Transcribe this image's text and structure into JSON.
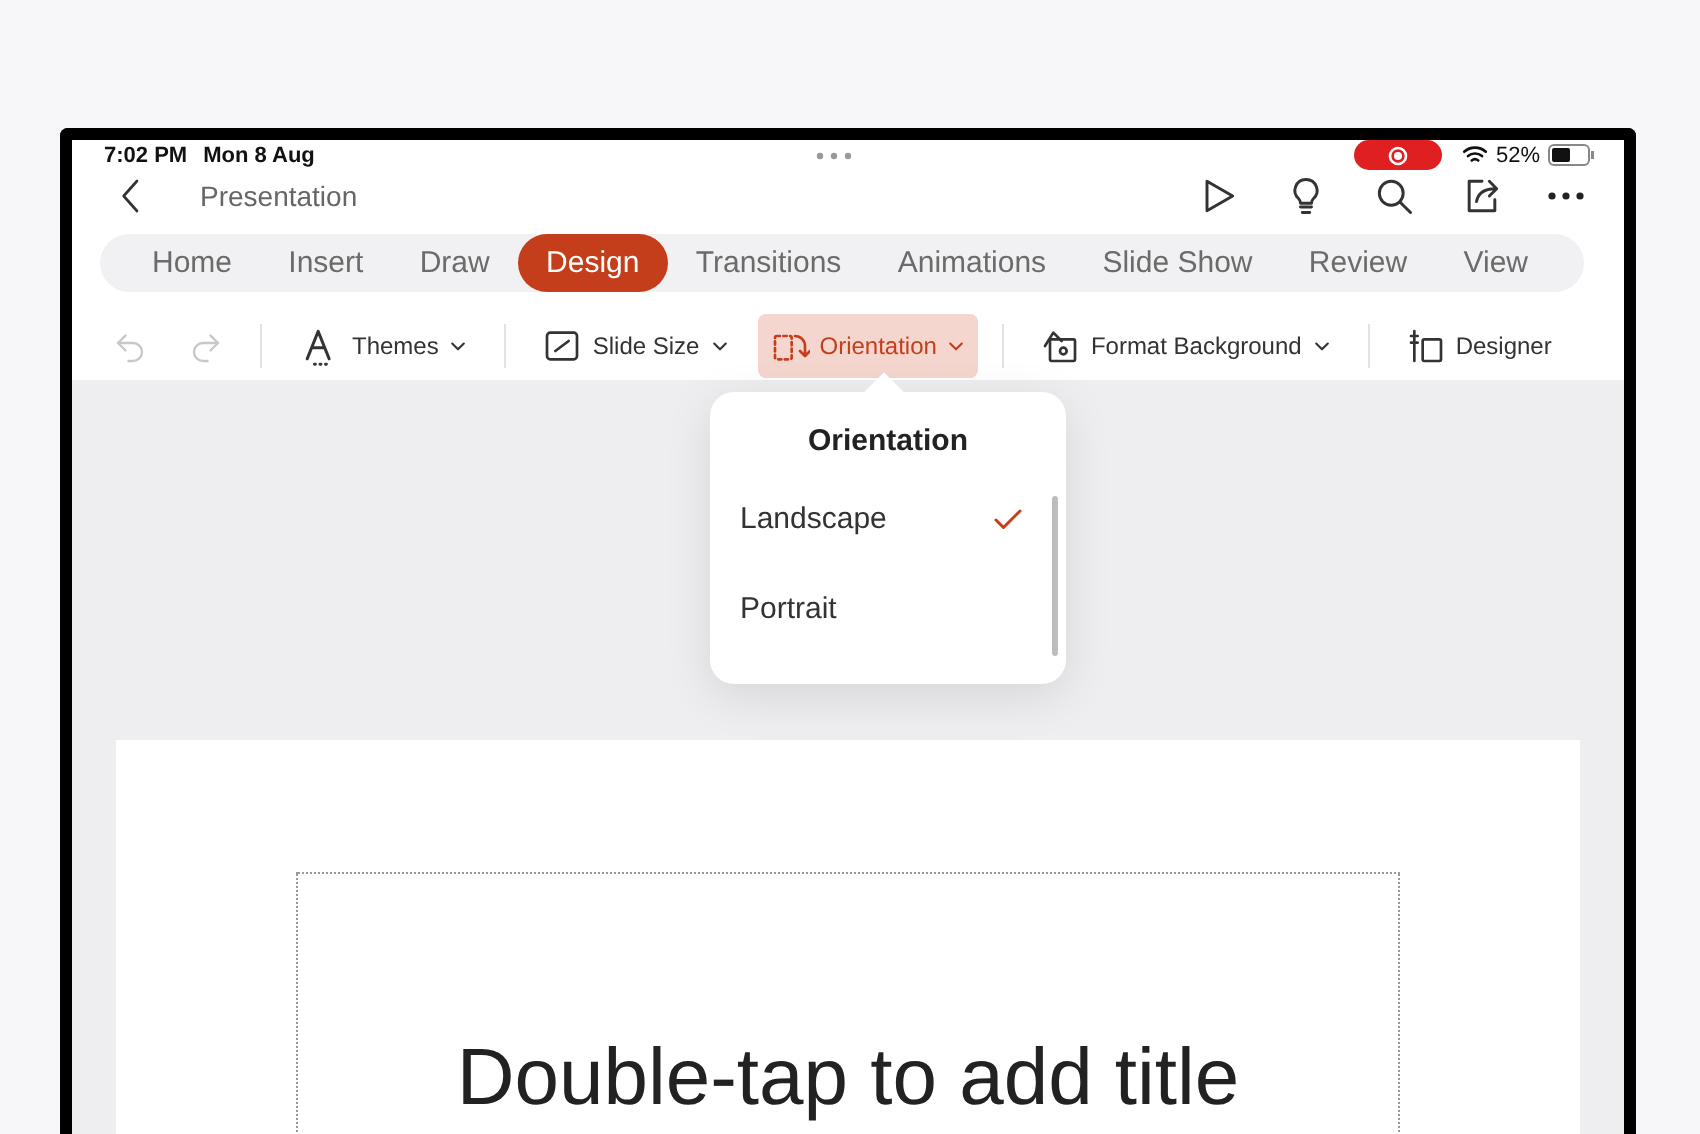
{
  "status_bar": {
    "time": "7:02 PM",
    "date": "Mon 8 Aug",
    "battery": "52%"
  },
  "nav": {
    "title": "Presentation"
  },
  "ribbon_tabs": [
    {
      "label": "Home",
      "selected": false
    },
    {
      "label": "Insert",
      "selected": false
    },
    {
      "label": "Draw",
      "selected": false
    },
    {
      "label": "Design",
      "selected": true
    },
    {
      "label": "Transitions",
      "selected": false
    },
    {
      "label": "Animations",
      "selected": false
    },
    {
      "label": "Slide Show",
      "selected": false
    },
    {
      "label": "Review",
      "selected": false
    },
    {
      "label": "View",
      "selected": false
    }
  ],
  "toolbar": [
    {
      "kind": "undo",
      "disabled": true
    },
    {
      "kind": "redo",
      "disabled": true
    },
    {
      "kind": "divider"
    },
    {
      "kind": "themes",
      "label": "Themes",
      "dropdown": true,
      "selected": false
    },
    {
      "kind": "divider"
    },
    {
      "kind": "slidesize",
      "label": "Slide Size",
      "dropdown": true,
      "selected": false
    },
    {
      "kind": "orientation",
      "label": "Orientation",
      "dropdown": true,
      "selected": true
    },
    {
      "kind": "divider"
    },
    {
      "kind": "background",
      "label": "Format Background",
      "dropdown": true,
      "selected": false
    },
    {
      "kind": "divider"
    },
    {
      "kind": "designer",
      "label": "Designer",
      "dropdown": false,
      "selected": false
    }
  ],
  "popover": {
    "title": "Orientation",
    "options": [
      {
        "label": "Landscape",
        "selected": true
      },
      {
        "label": "Portrait",
        "selected": false
      }
    ]
  },
  "slide": {
    "title_placeholder": "Double-tap to add title"
  }
}
